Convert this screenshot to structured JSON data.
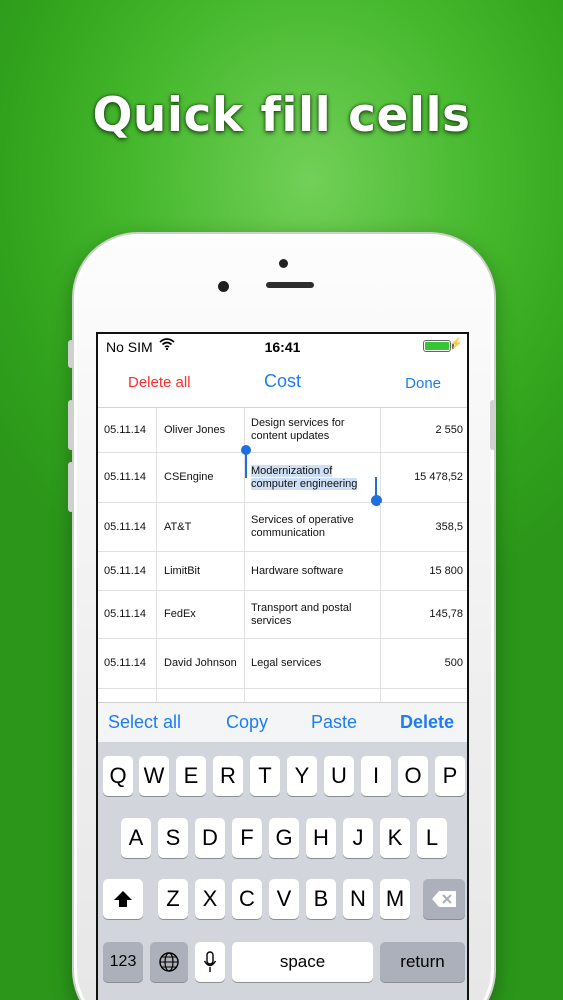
{
  "headline": "Quick fill cells",
  "status": {
    "carrier": "No SIM",
    "time": "16:41"
  },
  "nav": {
    "delete_all": "Delete all",
    "title": "Cost",
    "done": "Done"
  },
  "rows": [
    {
      "date": "05.11.14",
      "name": "Oliver Jones",
      "desc": "Design services for content updates",
      "amount": "2 550"
    },
    {
      "date": "05.11.14",
      "name": "CSEngine",
      "desc": "Modernization of computer engineering",
      "amount": "15 478,52",
      "selected": true
    },
    {
      "date": "05.11.14",
      "name": "AT&T",
      "desc": "Services of operative communication",
      "amount": "358,5"
    },
    {
      "date": "05.11.14",
      "name": "LimitBit",
      "desc": "Hardware software",
      "amount": "15 800"
    },
    {
      "date": "05.11.14",
      "name": "FedEx",
      "desc": "Transport and postal services",
      "amount": "145,78"
    },
    {
      "date": "05.11.14",
      "name": "David Johnson",
      "desc": "Legal services",
      "amount": "500"
    }
  ],
  "toolbar": {
    "select_all": "Select all",
    "copy": "Copy",
    "paste": "Paste",
    "delete": "Delete"
  },
  "keyboard": {
    "row1": [
      "Q",
      "W",
      "E",
      "R",
      "T",
      "Y",
      "U",
      "I",
      "O",
      "P"
    ],
    "row2": [
      "A",
      "S",
      "D",
      "F",
      "G",
      "H",
      "J",
      "K",
      "L"
    ],
    "row3": [
      "Z",
      "X",
      "C",
      "V",
      "B",
      "N",
      "M"
    ],
    "numbers": "123",
    "space": "space",
    "return": "return"
  },
  "icons": {
    "wifi": "wifi-icon",
    "battery": "battery-icon",
    "bolt": "charging-bolt-icon",
    "shift": "shift-arrow-icon",
    "backspace": "backspace-icon",
    "globe": "globe-icon",
    "mic": "microphone-icon"
  },
  "colors": {
    "accent": "#1e7cf5",
    "danger": "#ff2d2d",
    "battery": "#35c635",
    "background": "#3fae28"
  }
}
